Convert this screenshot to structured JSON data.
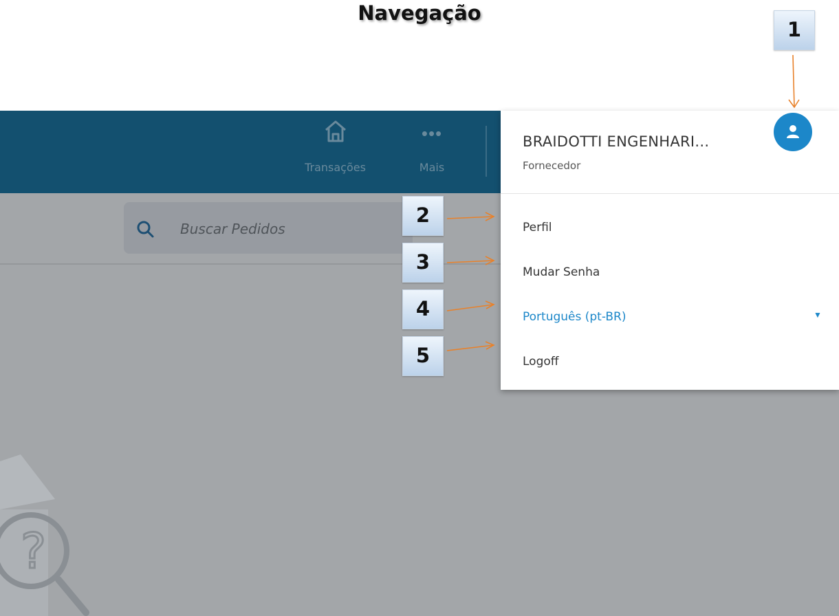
{
  "page_title": "Navegação",
  "topbar": {
    "nav": [
      {
        "label": "Transações",
        "icon": "home-icon"
      },
      {
        "label": "Mais",
        "icon": "more-dots-icon"
      }
    ],
    "more_dots": "•••"
  },
  "search": {
    "placeholder": "Buscar Pedidos",
    "icon": "search-icon"
  },
  "user_menu": {
    "name": "BRAIDOTTI ENGENHARI...",
    "role": "Fornecedor",
    "avatar_icon": "user-icon",
    "items": [
      {
        "label": "Perfil"
      },
      {
        "label": "Mudar Senha"
      },
      {
        "label": "Português (pt-BR)",
        "selected_language": true
      },
      {
        "label": "Logoff"
      }
    ]
  },
  "callouts": [
    "1",
    "2",
    "3",
    "4",
    "5"
  ],
  "colors": {
    "topbar": "#13506f",
    "accent": "#1c87c9",
    "overlay": "#a3a6a9",
    "callout_arrow": "#e8812a"
  }
}
